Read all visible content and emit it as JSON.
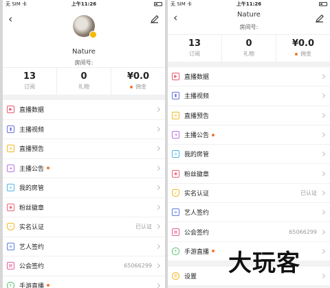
{
  "status": {
    "carrier": "无 SIM 卡",
    "time": "上午11:26"
  },
  "profile": {
    "name": "Nature",
    "room_label": "房间号:"
  },
  "stats": [
    {
      "value": "13",
      "label": "订阅"
    },
    {
      "value": "0",
      "label": "礼物"
    },
    {
      "value": "¥0.0",
      "label": "佣金"
    }
  ],
  "menu": [
    {
      "label": "直播数据",
      "icon": "play-icon",
      "color": "#e8566c"
    },
    {
      "label": "主播视频",
      "icon": "film-icon",
      "color": "#6a6fd8"
    },
    {
      "label": "直播预告",
      "icon": "calendar-icon",
      "color": "#f2b51d"
    },
    {
      "label": "主播公告",
      "icon": "megaphone-icon",
      "color": "#b672e0"
    },
    {
      "label": "我的房管",
      "icon": "house-icon",
      "color": "#4bb4e6"
    },
    {
      "label": "粉丝徽章",
      "icon": "badge-icon",
      "color": "#f06072"
    },
    {
      "label": "实名认证",
      "icon": "shield-icon",
      "color": "#f2b51d",
      "value": "已认证"
    },
    {
      "label": "艺人签约",
      "icon": "contract-icon",
      "color": "#5a7be0"
    },
    {
      "label": "公会签约",
      "icon": "guild-icon",
      "color": "#e85a9a",
      "value": "65066299"
    },
    {
      "label": "手游直播",
      "icon": "gamepad-icon",
      "color": "#4fbf6a"
    }
  ],
  "settings": {
    "label": "设置",
    "icon": "settings-icon",
    "color": "#f2b51d"
  },
  "watermark": "大玩客"
}
